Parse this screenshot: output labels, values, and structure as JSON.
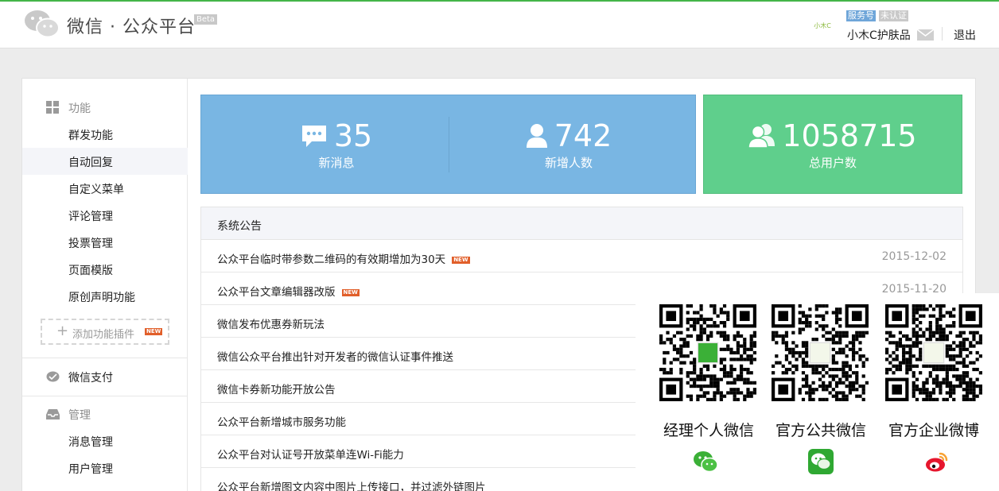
{
  "header": {
    "logo_text": "微信 · 公众平台",
    "beta": "Beta",
    "avatar_text": "小木C",
    "badge_service": "服务号",
    "badge_unverified": "未认证",
    "account_name": "小木C护肤品",
    "logout": "退出"
  },
  "sidebar": {
    "group_function": "功能",
    "function_items": [
      "群发功能",
      "自动回复",
      "自定义菜单",
      "评论管理",
      "投票管理",
      "页面模版",
      "原创声明功能"
    ],
    "add_plugin": "添加功能插件",
    "new_tag": "NEW",
    "group_pay": "微信支付",
    "group_manage": "管理",
    "manage_items": [
      "消息管理",
      "用户管理"
    ]
  },
  "stats": {
    "new_messages": {
      "value": "35",
      "label": "新消息"
    },
    "new_users": {
      "value": "742",
      "label": "新增人数"
    },
    "total_users": {
      "value": "1058715",
      "label": "总用户数"
    }
  },
  "notice": {
    "title": "系统公告",
    "items": [
      {
        "title": "公众平台临时带参数二维码的有效期增加为30天",
        "date": "2015-12-02",
        "new": true
      },
      {
        "title": "公众平台文章编辑器改版",
        "date": "2015-11-20",
        "new": true
      },
      {
        "title": "微信发布优惠券新玩法",
        "date": "",
        "new": false
      },
      {
        "title": "微信公众平台推出针对开发者的微信认证事件推送",
        "date": "",
        "new": false
      },
      {
        "title": "微信卡券新功能开放公告",
        "date": "",
        "new": false
      },
      {
        "title": "公众平台新增城市服务功能",
        "date": "",
        "new": false
      },
      {
        "title": "公众平台对认证号开放菜单连Wi-Fi能力",
        "date": "",
        "new": false
      },
      {
        "title": "公众平台新增图文内容中图片上传接口，并过滤外链图片",
        "date": "",
        "new": false
      }
    ]
  },
  "qr": {
    "items": [
      {
        "label": "经理个人微信",
        "icon": "wechat-icon"
      },
      {
        "label": "官方公共微信",
        "icon": "wechat-square-icon"
      },
      {
        "label": "官方企业微博",
        "icon": "weibo-icon"
      }
    ]
  },
  "colors": {
    "accent_green": "#44b549",
    "stat_blue": "#79b6e3",
    "stat_green": "#5fcf8c",
    "new_tag": "#e15f2a"
  }
}
